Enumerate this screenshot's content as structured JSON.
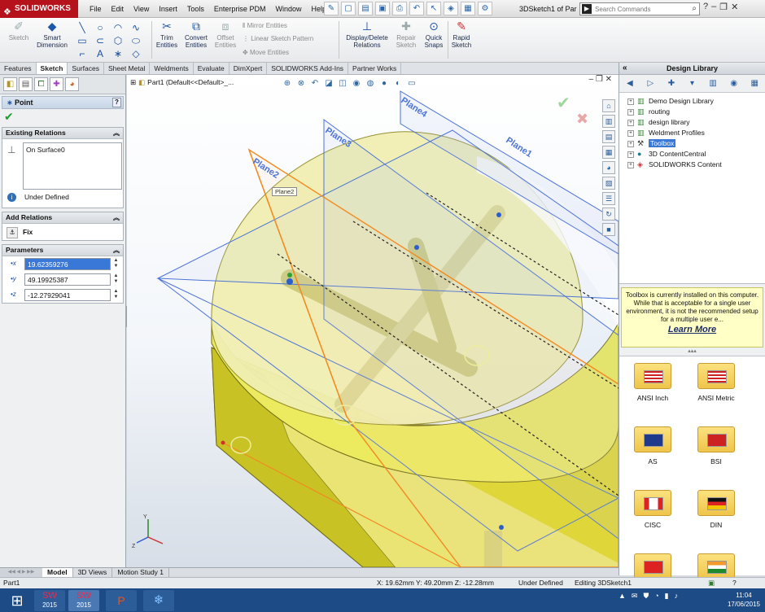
{
  "app": {
    "logo_text": "SOLIDWORKS",
    "menu": [
      "File",
      "Edit",
      "View",
      "Insert",
      "Tools",
      "Enterprise PDM",
      "Window",
      "Help"
    ],
    "document_title": "3DSketch1 of Par",
    "search_placeholder": "Search Commands"
  },
  "ribbon": {
    "sketch": "Sketch",
    "smart_dimension": [
      "Smart",
      "Dimension"
    ],
    "trim_entities": [
      "Trim",
      "Entities"
    ],
    "convert_entities": [
      "Convert",
      "Entities"
    ],
    "offset_entities": [
      "Offset",
      "Entities"
    ],
    "mirror_entities": "Mirror Entities",
    "linear_sketch_pattern": "Linear Sketch Pattern",
    "move_entities": "Move Entities",
    "display_delete_relations": [
      "Display/Delete",
      "Relations"
    ],
    "repair_sketch": [
      "Repair",
      "Sketch"
    ],
    "quick_snaps": [
      "Quick",
      "Snaps"
    ],
    "rapid_sketch": [
      "Rapid",
      "Sketch"
    ]
  },
  "command_tabs": [
    "Features",
    "Sketch",
    "Surfaces",
    "Sheet Metal",
    "Weldments",
    "Evaluate",
    "DimXpert",
    "SOLIDWORKS Add-Ins",
    "Partner Works"
  ],
  "property_manager": {
    "title": "Point",
    "existing_relations_title": "Existing Relations",
    "relations": [
      "On Surface0"
    ],
    "status": "Under Defined",
    "add_relations_title": "Add Relations",
    "fix_label": "Fix",
    "parameters_title": "Parameters",
    "x_value": "19.62359276",
    "y_value": "49.19925387",
    "z_value": "-12.27929041"
  },
  "viewport": {
    "tree_label": "Part1  (Default<<Default>_...",
    "tooltip": "Plane2",
    "plane_labels": [
      "Plane2",
      "Plane3",
      "Plane4",
      "Plane1"
    ]
  },
  "design_library": {
    "title": "Design Library",
    "tree": [
      "Demo Design Library",
      "routing",
      "design library",
      "Weldment Profiles",
      "Toolbox",
      "3D ContentCentral",
      "SOLIDWORKS Content"
    ],
    "selected": "Toolbox",
    "notice": "Toolbox is currently installed on this computer. While that is acceptable for a single user environment, it is not the recommended setup for a multiple user e...",
    "learn_more": "Learn More",
    "folders": [
      "ANSI Inch",
      "ANSI Metric",
      "AS",
      "BSI",
      "CISC",
      "DIN",
      "",
      ""
    ]
  },
  "view_tabs": [
    "Model",
    "3D Views",
    "Motion Study 1"
  ],
  "status_bar": {
    "part": "Part1",
    "coords": "X: 19.62mm Y: 49.20mm Z: -12.28mm",
    "state": "Under Defined",
    "editing": "Editing 3DSketch1"
  },
  "taskbar": {
    "apps": [
      "2015",
      "2015",
      "",
      ""
    ],
    "time": "11:04",
    "date": "17/06/2015"
  },
  "colors": {
    "model_yellow": "#e3e07a",
    "plane_blue": "#4b73d6",
    "plane_orange": "#f28a22",
    "selection_blue": "#3a78d8",
    "taskbar": "#1c4b85"
  }
}
